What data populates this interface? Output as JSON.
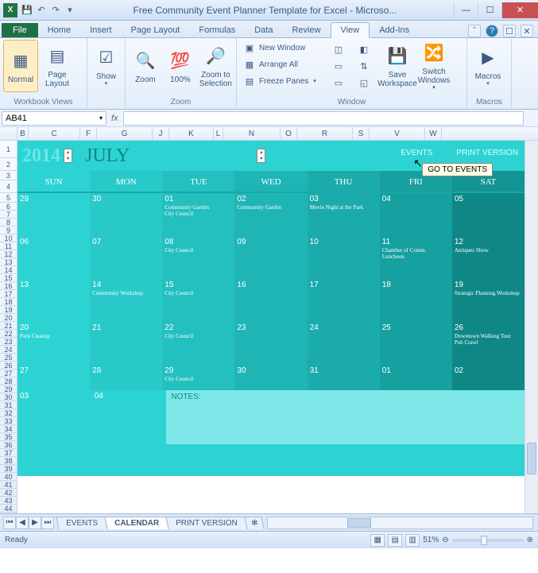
{
  "titlebar": {
    "app_icon": "X",
    "title": "Free Community Event Planner Template for Excel - Microso..."
  },
  "tabs": {
    "file": "File",
    "items": [
      "Home",
      "Insert",
      "Page Layout",
      "Formulas",
      "Data",
      "Review",
      "View",
      "Add-Ins"
    ],
    "active": "View"
  },
  "ribbon": {
    "workbook_views": {
      "label": "Workbook Views",
      "normal": "Normal",
      "page_layout": "Page\nLayout"
    },
    "show": {
      "label": "Show",
      "btn": "Show"
    },
    "zoom": {
      "label": "Zoom",
      "zoom": "Zoom",
      "hundred": "100%",
      "to_selection": "Zoom to\nSelection"
    },
    "window": {
      "label": "Window",
      "new_window": "New Window",
      "arrange_all": "Arrange All",
      "freeze_panes": "Freeze Panes",
      "save_workspace": "Save\nWorkspace",
      "switch_windows": "Switch\nWindows"
    },
    "macros": {
      "label": "Macros",
      "btn": "Macros"
    }
  },
  "formula_bar": {
    "namebox": "AB41",
    "fx": "fx"
  },
  "columns": [
    "B",
    "C",
    "F",
    "G",
    "J",
    "K",
    "L",
    "N",
    "O",
    "R",
    "S",
    "V",
    "W"
  ],
  "rows_left": [
    "1",
    "2",
    "3",
    "4",
    "5",
    "6",
    "7",
    "8",
    "9",
    "10",
    "11",
    "12",
    "13",
    "14",
    "15",
    "16",
    "17",
    "18",
    "19",
    "20",
    "21",
    "22",
    "23",
    "24",
    "25",
    "26",
    "27",
    "28",
    "29",
    "30",
    "31",
    "32",
    "33",
    "34",
    "35",
    "36",
    "37",
    "38",
    "39",
    "40",
    "41",
    "42",
    "43",
    "44"
  ],
  "calendar": {
    "year": "2014",
    "month": "JULY",
    "link_events": "EVENTS",
    "link_print": "PRINT VERSION",
    "tooltip": "GO TO EVENTS",
    "days": [
      "SUN",
      "MON",
      "TUE",
      "WED",
      "THU",
      "FRI",
      "SAT"
    ],
    "weeks": [
      [
        {
          "n": "29",
          "e": []
        },
        {
          "n": "30",
          "e": []
        },
        {
          "n": "01",
          "e": [
            "Community Garden",
            "City Council"
          ]
        },
        {
          "n": "02",
          "e": [
            "Community Garden"
          ]
        },
        {
          "n": "03",
          "e": [
            "Movie Night at the Park"
          ]
        },
        {
          "n": "04",
          "e": []
        },
        {
          "n": "05",
          "e": []
        }
      ],
      [
        {
          "n": "06",
          "e": []
        },
        {
          "n": "07",
          "e": []
        },
        {
          "n": "08",
          "e": [
            "City Council"
          ]
        },
        {
          "n": "09",
          "e": []
        },
        {
          "n": "10",
          "e": []
        },
        {
          "n": "11",
          "e": [
            "Chamber of Comm. Luncheon"
          ]
        },
        {
          "n": "12",
          "e": [
            "Antiques Show"
          ]
        }
      ],
      [
        {
          "n": "13",
          "e": []
        },
        {
          "n": "14",
          "e": [
            "Community Workshop"
          ]
        },
        {
          "n": "15",
          "e": [
            "City Council"
          ]
        },
        {
          "n": "16",
          "e": []
        },
        {
          "n": "17",
          "e": []
        },
        {
          "n": "18",
          "e": []
        },
        {
          "n": "19",
          "e": [
            "Strategic Planning Workshop"
          ]
        }
      ],
      [
        {
          "n": "20",
          "e": [
            "Park Cleanup"
          ]
        },
        {
          "n": "21",
          "e": []
        },
        {
          "n": "22",
          "e": [
            "City Council"
          ]
        },
        {
          "n": "23",
          "e": []
        },
        {
          "n": "24",
          "e": []
        },
        {
          "n": "25",
          "e": []
        },
        {
          "n": "26",
          "e": [
            "Downtown Walking Tour",
            "Pub Crawl"
          ]
        }
      ],
      [
        {
          "n": "27",
          "e": []
        },
        {
          "n": "28",
          "e": []
        },
        {
          "n": "29",
          "e": [
            "City Council"
          ]
        },
        {
          "n": "30",
          "e": []
        },
        {
          "n": "31",
          "e": []
        },
        {
          "n": "01",
          "e": []
        },
        {
          "n": "02",
          "e": []
        }
      ]
    ],
    "notes_row": [
      {
        "n": "03"
      },
      {
        "n": "04"
      }
    ],
    "notes_label": "NOTES:"
  },
  "sheet_tabs": {
    "items": [
      "EVENTS",
      "CALENDAR",
      "PRINT VERSION"
    ],
    "active": "CALENDAR"
  },
  "status": {
    "ready": "Ready",
    "zoom_pct": "51%"
  }
}
